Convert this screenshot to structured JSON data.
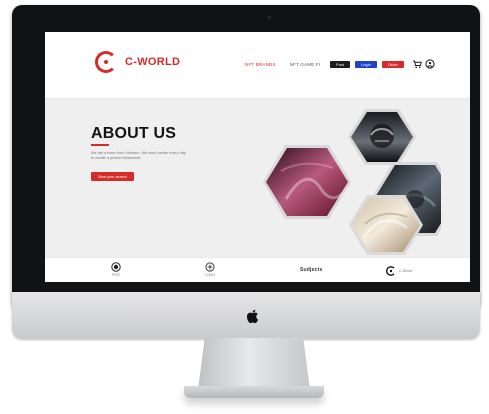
{
  "device": {
    "apple_logo_icon": "apple-icon"
  },
  "site": {
    "brand": {
      "name": "C-WORLD",
      "accent_color": "#d52b2b"
    },
    "nav": {
      "items": [
        {
          "label": "NFT BRANDS",
          "active": true
        },
        {
          "label": "NFT GAME FI",
          "active": false
        }
      ],
      "buttons": [
        {
          "label": "Post",
          "style": "dark"
        },
        {
          "label": "Login",
          "style": "blue"
        },
        {
          "label": "Order",
          "style": "red"
        }
      ],
      "icons": [
        "cart-icon",
        "user-icon"
      ]
    },
    "hero": {
      "title": "ABOUT US",
      "description": "We are a team from Vietnam. We work harder every day to create a perfect Metaverse.",
      "cta_label": "Start your search"
    },
    "partners": [
      {
        "label": "PHỞ",
        "icon": "partner-seal-icon"
      },
      {
        "label": "LOGO",
        "icon": "partner-emblem-icon"
      },
      {
        "label": "Sudjects",
        "icon": "partner-wordmark"
      },
      {
        "label": "C-World",
        "icon": "partner-c-world-icon"
      }
    ]
  }
}
